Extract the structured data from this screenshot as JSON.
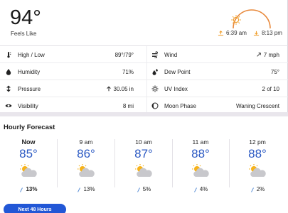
{
  "current": {
    "temp": "94°",
    "feels_like": "Feels Like"
  },
  "sun": {
    "sunrise": "6:39 am",
    "sunset": "8:13 pm"
  },
  "details": [
    {
      "left_label": "High / Low",
      "left_value": "89°/79°",
      "right_label": "Wind",
      "right_value": "7 mph"
    },
    {
      "left_label": "Humidity",
      "left_value": "71%",
      "right_label": "Dew Point",
      "right_value": "75°"
    },
    {
      "left_label": "Pressure",
      "left_value": "30.05 in",
      "right_label": "UV Index",
      "right_value": "2 of 10"
    },
    {
      "left_label": "Visibility",
      "left_value": "8 mi",
      "right_label": "Moon Phase",
      "right_value": "Waning Crescent"
    }
  ],
  "hourly": {
    "title": "Hourly Forecast",
    "hours": [
      {
        "time": "Now",
        "temp": "85°",
        "precip": "13%"
      },
      {
        "time": "9 am",
        "temp": "86°",
        "precip": "13%"
      },
      {
        "time": "10 am",
        "temp": "87°",
        "precip": "5%"
      },
      {
        "time": "11 am",
        "temp": "88°",
        "precip": "4%"
      },
      {
        "time": "12 pm",
        "temp": "88°",
        "precip": "2%"
      }
    ],
    "next_button": "Next 48 Hours"
  },
  "colors": {
    "accent": "#2257d6",
    "temp_blue": "#2b59c3",
    "sun_orange": "#e8883a"
  },
  "icons": [
    "thermometer-icon",
    "humidity-drop-icon",
    "pressure-icon",
    "visibility-eye-icon",
    "wind-icon",
    "dew-point-icon",
    "uv-index-icon",
    "moon-phase-icon",
    "partly-cloudy-icon"
  ]
}
